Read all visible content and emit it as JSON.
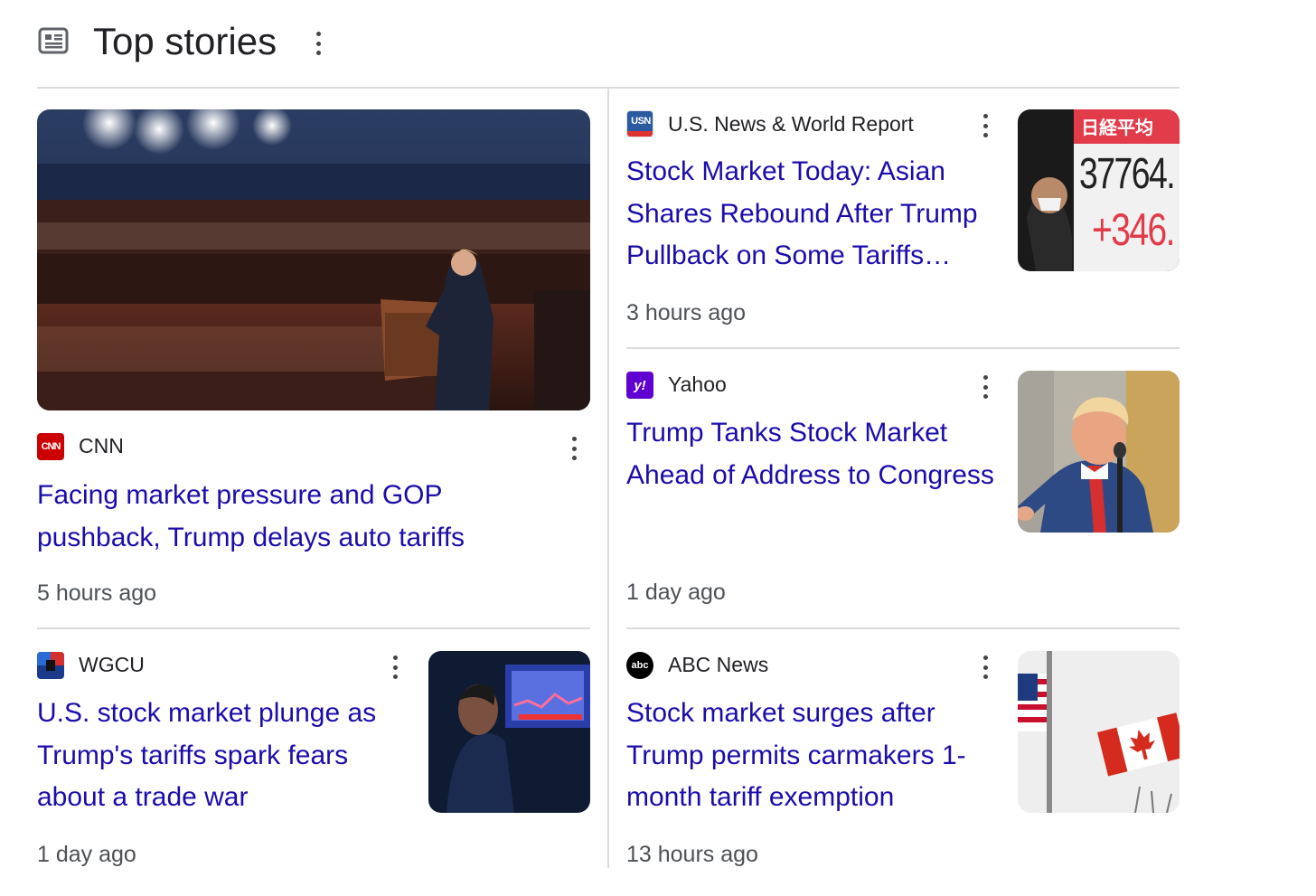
{
  "header": {
    "title": "Top stories",
    "icon": "newspaper-icon",
    "menu_icon": "more-vert-icon"
  },
  "colors": {
    "headline": "#1a0dab",
    "source": "#202124",
    "time": "#4d5156",
    "divider": "#dadce0",
    "cnn": "#cc0000",
    "usn": "#2c5aa0",
    "yahoo": "#6001d2",
    "wgcu": "#1a3a8c",
    "abc": "#000000"
  },
  "stories": [
    {
      "source": "CNN",
      "logo_text": "CNN",
      "headline": "Facing market pressure and GOP pushback, Trump delays auto tariffs",
      "time": "5 hours ago",
      "image": "congress-address-photo"
    },
    {
      "source": "U.S. News & World Report",
      "logo_text": "USN",
      "headline": "Stock Market Today: Asian Shares Rebound After Trump Pullback on Some Tariffs…",
      "time": "3 hours ago",
      "image": "nikkei-board-photo",
      "image_text_1": "日経平均",
      "image_text_2": "37764.",
      "image_text_3": "+346."
    },
    {
      "source": "Yahoo",
      "logo_text": "y!",
      "headline": "Trump Tanks Stock Market Ahead of Address to Congress",
      "time": "1 day ago",
      "image": "trump-speaking-photo"
    },
    {
      "source": "WGCU",
      "logo_text": "",
      "headline": "U.S. stock market plunge as Trump's tariffs spark fears about a trade war",
      "time": "1 day ago",
      "image": "trading-floor-photo"
    },
    {
      "source": "ABC News",
      "logo_text": "abc",
      "headline": "Stock market surges after Trump permits carmakers 1-month tariff exemption",
      "time": "13 hours ago",
      "image": "flags-photo"
    }
  ]
}
